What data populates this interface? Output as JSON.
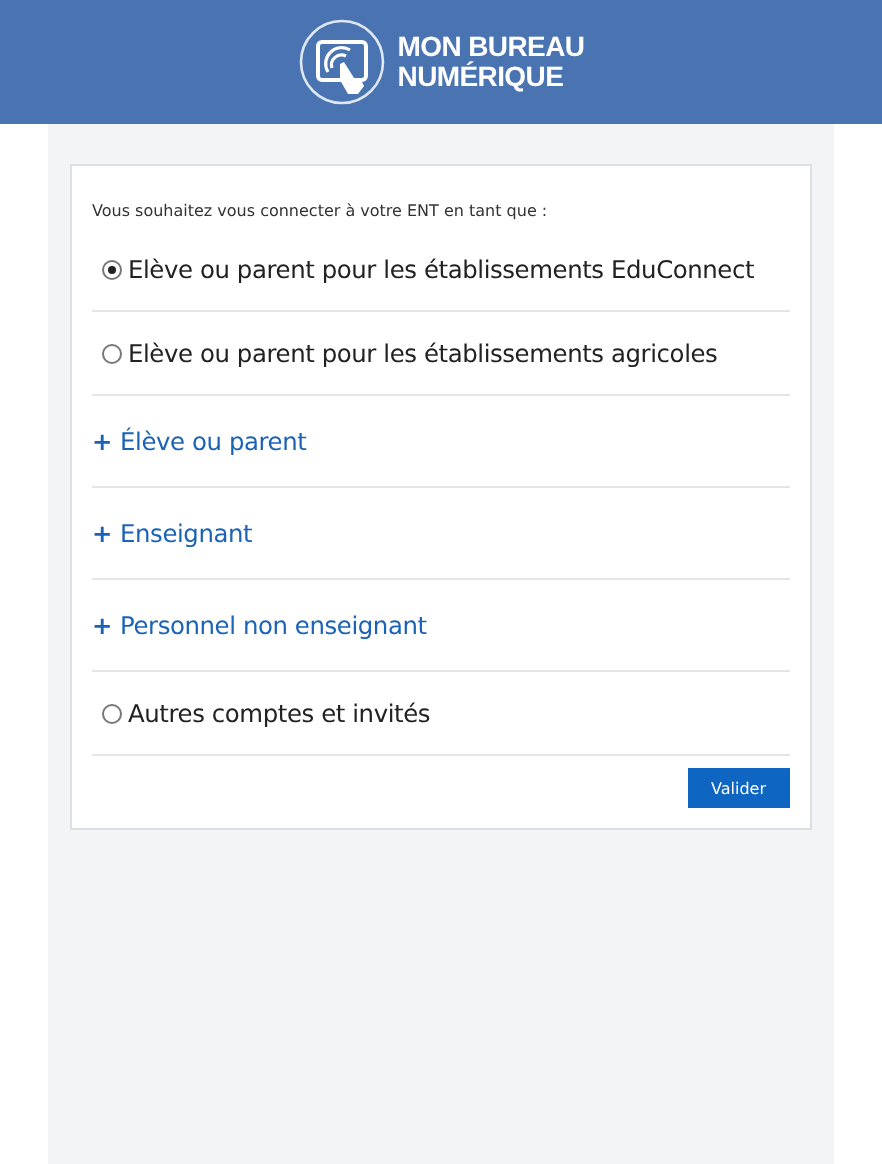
{
  "header": {
    "logo_lines": [
      "MON BUREAU",
      "NUMÉRIQUE"
    ]
  },
  "form": {
    "intro": "Vous souhaitez vous connecter à votre ENT en tant que :",
    "options": [
      {
        "kind": "radio",
        "label": "Elève ou parent pour les établissements EduConnect",
        "selected": true
      },
      {
        "kind": "radio",
        "label": "Elève ou parent pour les établissements agricoles",
        "selected": false
      },
      {
        "kind": "expand",
        "symbol": "+",
        "label": "Élève ou parent"
      },
      {
        "kind": "expand",
        "symbol": "+",
        "label": "Enseignant"
      },
      {
        "kind": "expand",
        "symbol": "+",
        "label": "Personnel non enseignant"
      },
      {
        "kind": "radio",
        "label": "Autres comptes et invités",
        "selected": false
      }
    ],
    "submit": "Valider"
  }
}
